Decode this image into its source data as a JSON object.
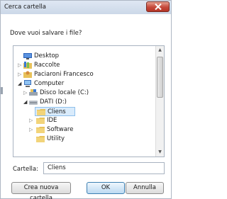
{
  "window": {
    "title": "Cerca cartella"
  },
  "prompt": "Dove vuoi salvare i file?",
  "tree": {
    "items": [
      {
        "label": "Desktop",
        "icon": "desktop-icon",
        "expander": "none"
      },
      {
        "label": "Raccolte",
        "icon": "library-icon",
        "expander": "collapsed"
      },
      {
        "label": "Paciaroni Francesco",
        "icon": "user-folder-icon",
        "expander": "collapsed"
      },
      {
        "label": "Computer",
        "icon": "computer-icon",
        "expander": "expanded"
      },
      {
        "label": "Disco locale (C:)",
        "icon": "drive-icon",
        "expander": "collapsed"
      },
      {
        "label": "DATI (D:)",
        "icon": "drive-icon",
        "expander": "expanded"
      },
      {
        "label": "Cliens",
        "icon": "folder-icon",
        "expander": "none",
        "selected": true
      },
      {
        "label": "IDE",
        "icon": "folder-icon",
        "expander": "collapsed"
      },
      {
        "label": "Software",
        "icon": "folder-icon",
        "expander": "collapsed"
      },
      {
        "label": "Utility",
        "icon": "folder-icon",
        "expander": "none"
      }
    ]
  },
  "folder_field": {
    "label": "Cartella:",
    "value": "Cliens"
  },
  "buttons": {
    "new_folder": "Crea nuova cartella",
    "ok": "OK",
    "cancel": "Annulla"
  },
  "colors": {
    "selection_bg": "#d9ebfb",
    "selection_border": "#8fc0ec",
    "close_button": "#c5483a",
    "folder": "#e8c25a"
  }
}
